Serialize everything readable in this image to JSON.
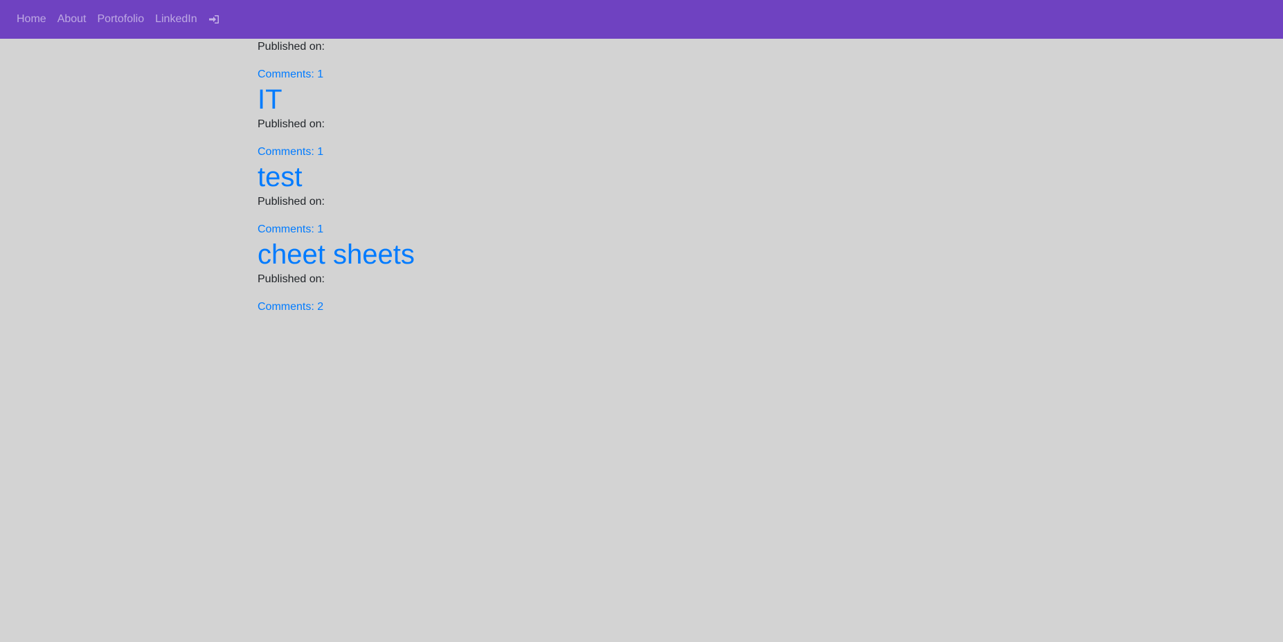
{
  "nav": {
    "items": [
      {
        "label": "Home"
      },
      {
        "label": "About"
      },
      {
        "label": "Portofolio"
      },
      {
        "label": "LinkedIn"
      }
    ],
    "login_icon": "sign-in-icon",
    "background_color": "#6f42c1"
  },
  "posts": [
    {
      "title": "",
      "published_label": "Published on:",
      "comments_label": "Comments: 1"
    },
    {
      "title": "IT",
      "published_label": "Published on:",
      "comments_label": "Comments: 1"
    },
    {
      "title": "test",
      "published_label": "Published on:",
      "comments_label": "Comments: 1"
    },
    {
      "title": "cheet sheets",
      "published_label": "Published on:",
      "comments_label": "Comments: 2"
    }
  ],
  "colors": {
    "page_background": "#d3d3d3",
    "link": "#007bff",
    "text": "#212529"
  }
}
